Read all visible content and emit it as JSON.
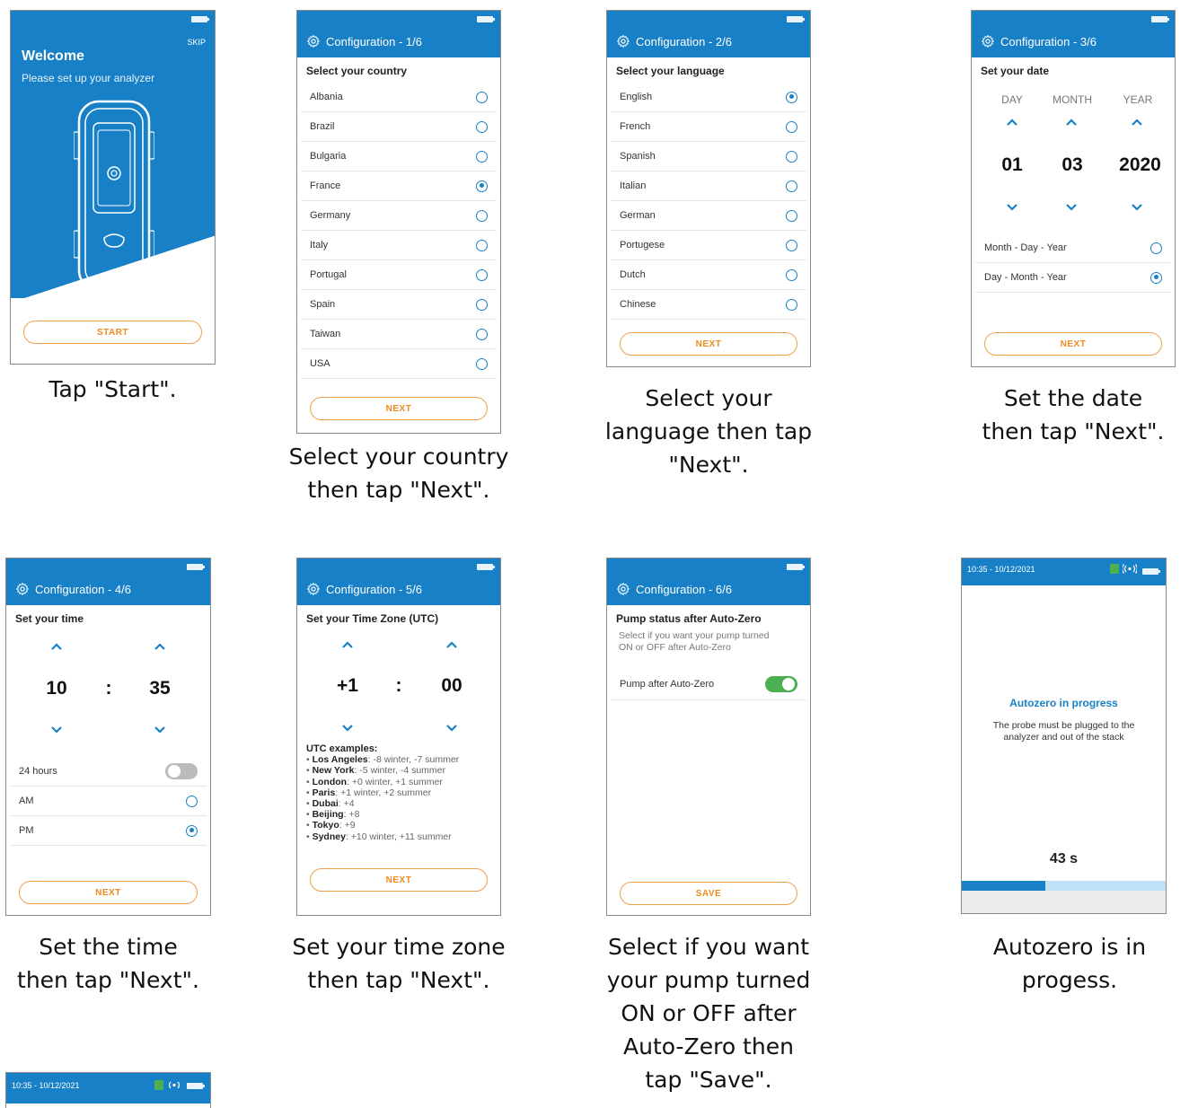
{
  "s1": {
    "skip": "SKIP",
    "title": "Welcome",
    "subtitle": "Please set up your analyzer",
    "button": "START",
    "caption": "Tap \"Start\"."
  },
  "s2": {
    "header": "Configuration - 1/6",
    "section": "Select your country",
    "items": [
      {
        "label": "Albania",
        "selected": false
      },
      {
        "label": "Brazil",
        "selected": false
      },
      {
        "label": "Bulgaria",
        "selected": false
      },
      {
        "label": "France",
        "selected": true
      },
      {
        "label": "Germany",
        "selected": false
      },
      {
        "label": "Italy",
        "selected": false
      },
      {
        "label": "Portugal",
        "selected": false
      },
      {
        "label": "Spain",
        "selected": false
      },
      {
        "label": "Taiwan",
        "selected": false
      },
      {
        "label": "USA",
        "selected": false
      }
    ],
    "button": "NEXT",
    "caption1": "Select your country",
    "caption2": "then tap \"Next\"."
  },
  "s3": {
    "header": "Configuration - 2/6",
    "section": "Select your language",
    "items": [
      {
        "label": "English",
        "selected": true
      },
      {
        "label": "French",
        "selected": false
      },
      {
        "label": "Spanish",
        "selected": false
      },
      {
        "label": "Italian",
        "selected": false
      },
      {
        "label": "German",
        "selected": false
      },
      {
        "label": "Portugese",
        "selected": false
      },
      {
        "label": "Dutch",
        "selected": false
      },
      {
        "label": "Chinese",
        "selected": false
      }
    ],
    "button": "NEXT",
    "caption1": "Select your",
    "caption2": "language then tap",
    "caption3": "\"Next\"."
  },
  "s4": {
    "header": "Configuration - 3/6",
    "section": "Set your date",
    "day_label": "DAY",
    "month_label": "MONTH",
    "year_label": "YEAR",
    "day": "01",
    "month": "03",
    "year": "2020",
    "formats": [
      {
        "label": "Month - Day - Year",
        "selected": false
      },
      {
        "label": "Day - Month - Year",
        "selected": true
      }
    ],
    "button": "NEXT",
    "caption1": "Set the date",
    "caption2": "then tap \"Next\"."
  },
  "s5": {
    "header": "Configuration - 4/6",
    "section": "Set your time",
    "hours": "10",
    "sep": ":",
    "minutes": "35",
    "h24_label": "24 hours",
    "h24_on": false,
    "am": "AM",
    "pm": "PM",
    "am_selected": false,
    "pm_selected": true,
    "button": "NEXT",
    "caption1": "Set the time",
    "caption2": "then tap \"Next\"."
  },
  "s6": {
    "header": "Configuration - 5/6",
    "section": "Set your Time Zone (UTC)",
    "hours": "+1",
    "sep": ":",
    "minutes": "00",
    "examples_title": "UTC examples:",
    "examples": [
      {
        "city": "Los Angeles",
        "value": ": -8 winter, -7 summer"
      },
      {
        "city": "New York",
        "value": ": -5 winter, -4 summer"
      },
      {
        "city": "London",
        "value": ": +0 winter, +1 summer"
      },
      {
        "city": "Paris",
        "value": ": +1 winter, +2 summer"
      },
      {
        "city": "Dubai",
        "value": ": +4"
      },
      {
        "city": "Beijing",
        "value": ": +8"
      },
      {
        "city": "Tokyo",
        "value": ": +9"
      },
      {
        "city": "Sydney",
        "value": ": +10 winter, +11 summer"
      }
    ],
    "button": "NEXT",
    "caption1": "Set your time zone",
    "caption2": "then tap \"Next\"."
  },
  "s7": {
    "header": "Configuration - 6/6",
    "section": "Pump status after Auto-Zero",
    "desc1": "Select if you want your pump turned",
    "desc2": "ON or OFF after Auto-Zero",
    "toggle_label": "Pump after Auto-Zero",
    "toggle_on": true,
    "button": "SAVE",
    "caption1": "Select if you want",
    "caption2": "your pump turned",
    "caption3": "ON or OFF after",
    "caption4": "Auto-Zero then",
    "caption5": "tap \"Save\"."
  },
  "s8": {
    "status_time": "10:35 - 10/12/2021",
    "title": "Autozero in progress",
    "desc1": "The probe must be plugged to the",
    "desc2": "analyzer and out of the stack",
    "countdown": "43 s",
    "progress": 0.41,
    "caption": "Autozero is in progess."
  },
  "s9": {
    "status_time": "10:35 - 10/12/2021"
  },
  "colors": {
    "primary": "#1780c6",
    "accent": "#f08a1e",
    "toggle_on": "#4caf50"
  }
}
